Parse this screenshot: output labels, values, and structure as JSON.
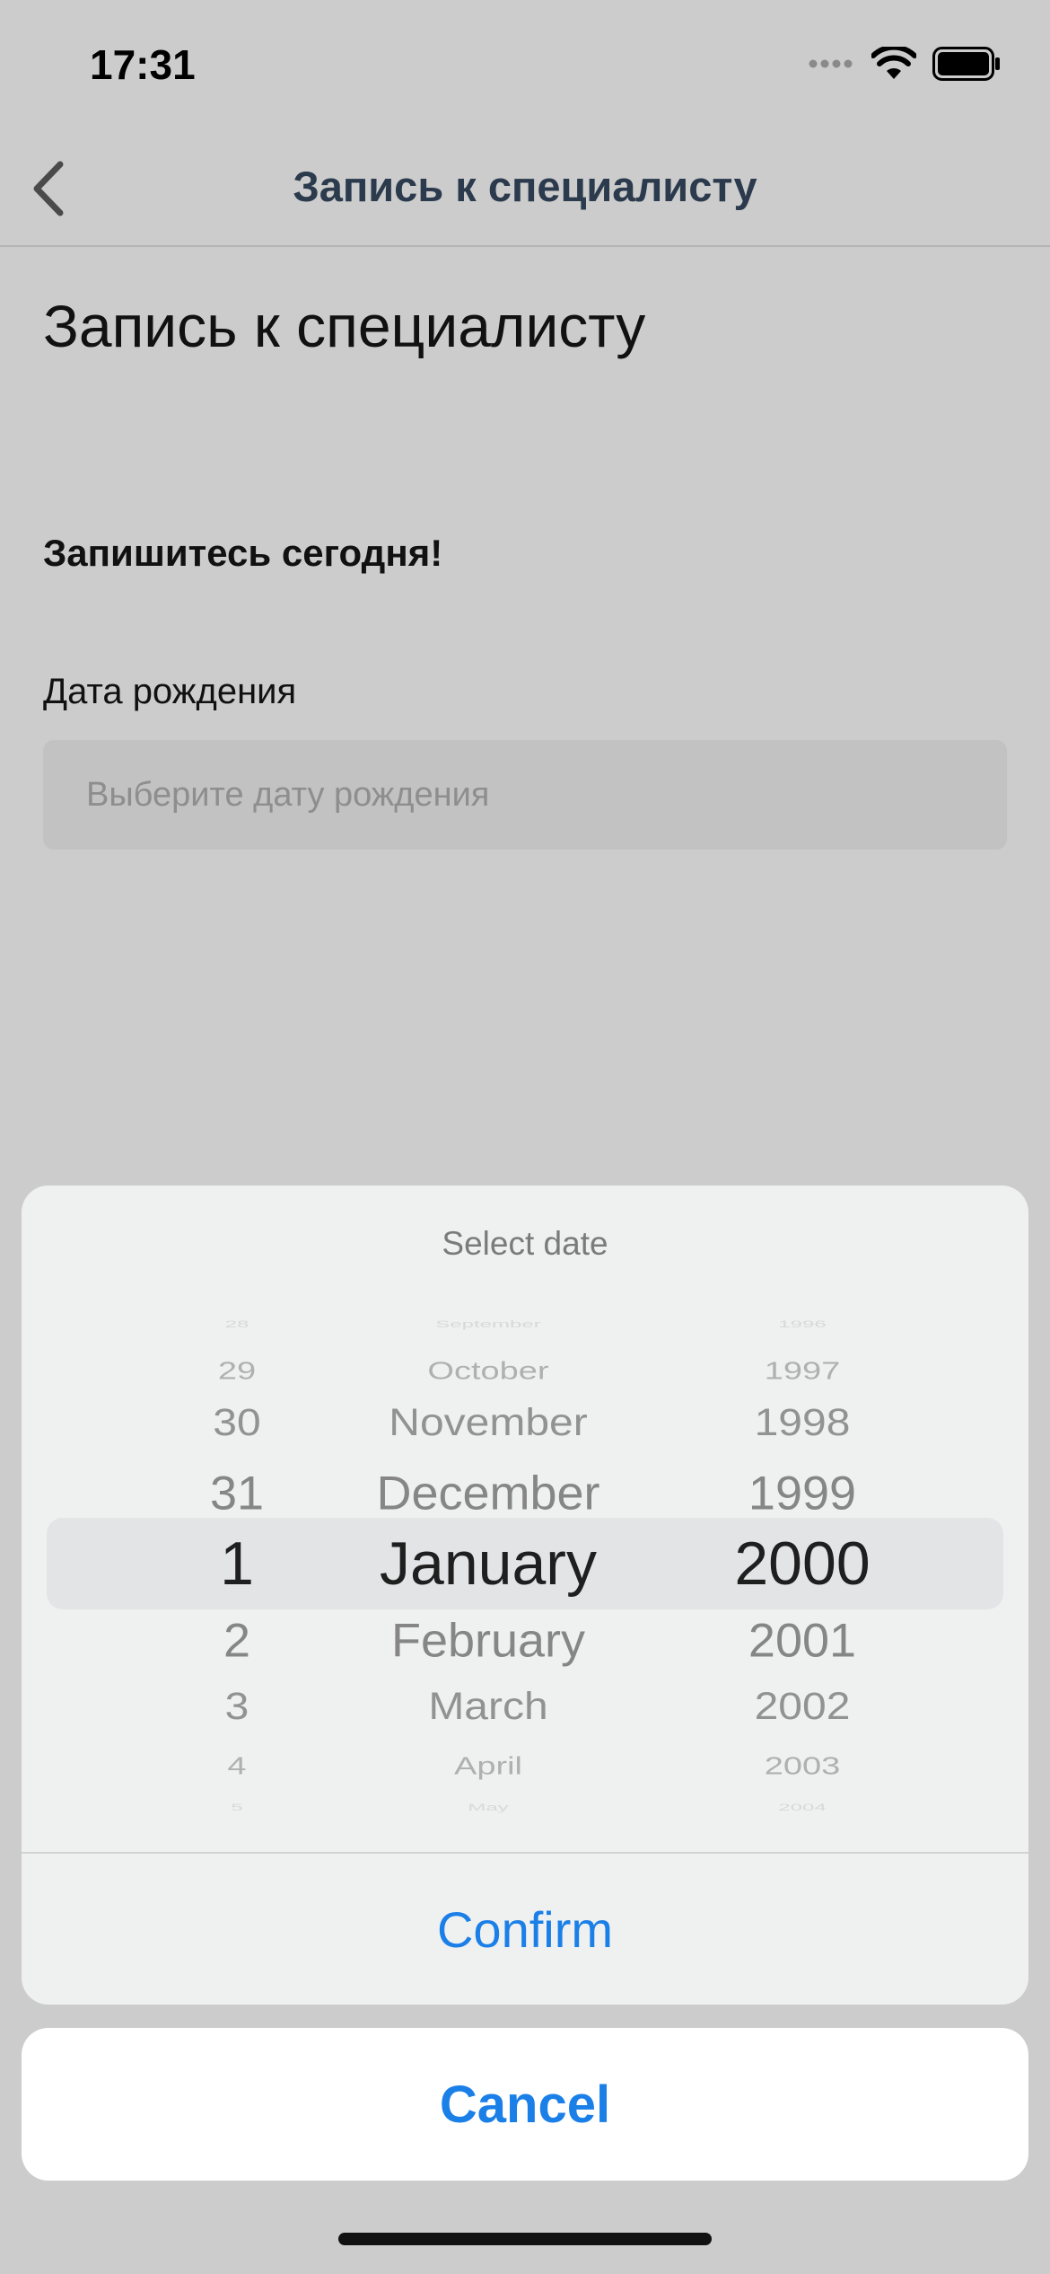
{
  "status_bar": {
    "time": "17:31",
    "icons": [
      "signal-icon",
      "wifi-icon",
      "battery-icon"
    ]
  },
  "nav": {
    "title": "Запись к специалисту",
    "back_icon": "chevron-left-icon"
  },
  "page": {
    "title": "Запись к специалисту",
    "promo": "Запишитесь сегодня!",
    "birthdate": {
      "label": "Дата рождения",
      "value": "",
      "placeholder": "Выберите дату рождения"
    }
  },
  "date_picker": {
    "title": "Select date",
    "days": [
      "28",
      "29",
      "30",
      "31",
      "1",
      "2",
      "3",
      "4",
      "5"
    ],
    "months": [
      "September",
      "October",
      "November",
      "December",
      "January",
      "February",
      "March",
      "April",
      "May"
    ],
    "years": [
      "1996",
      "1997",
      "1998",
      "1999",
      "2000",
      "2001",
      "2002",
      "2003",
      "2004"
    ],
    "selected": {
      "day": "1",
      "month": "January",
      "year": "2000"
    },
    "confirm_label": "Confirm",
    "cancel_label": "Cancel"
  },
  "colors": {
    "accent": "#1b7fe8",
    "overlay_bg": "#cccccc",
    "sheet_bg": "#eff0f0",
    "nav_title": "#2b3a4c"
  }
}
